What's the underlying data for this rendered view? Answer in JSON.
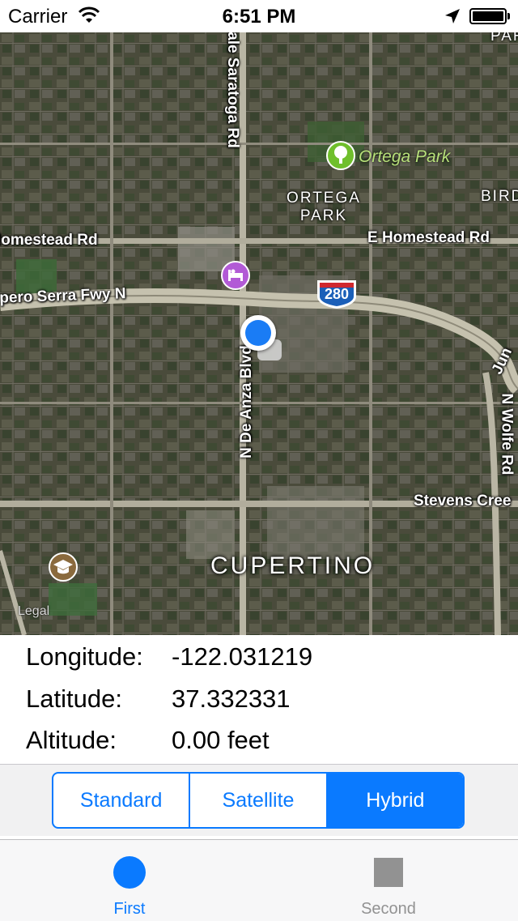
{
  "status_bar": {
    "carrier": "Carrier",
    "time": "6:51 PM"
  },
  "map": {
    "roads": {
      "saratoga": "ale Saratoga Rd",
      "homestead_w": "lomestead Rd",
      "homestead_e": "E Homestead Rd",
      "junipero": "ipero Serra Fwy N",
      "de_anza": "N De Anza Blvd",
      "wolfe": "N Wolfe Rd",
      "stevens": "Stevens Cree",
      "jun_fragment": "Jun",
      "par_fragment": "PAR",
      "bird_fragment": "BIRD"
    },
    "areas": {
      "ortega_line1": "ORTEGA",
      "ortega_line2": "PARK"
    },
    "poi": {
      "ortega_park": "Ortega Park"
    },
    "highway_shield": "280",
    "city": "CUPERTINO",
    "legal": "Legal"
  },
  "location": {
    "longitude_label": "Longitude:",
    "longitude_value": "-122.031219",
    "latitude_label": "Latitude:",
    "latitude_value": "37.332331",
    "altitude_label": "Altitude:",
    "altitude_value": "0.00 feet"
  },
  "map_type": {
    "options": [
      "Standard",
      "Satellite",
      "Hybrid"
    ],
    "selected": "Hybrid"
  },
  "tab_bar": {
    "tabs": [
      {
        "label": "First",
        "icon": "circle-icon",
        "active": true
      },
      {
        "label": "Second",
        "icon": "square-icon",
        "active": false
      }
    ]
  },
  "colors": {
    "accent": "#0a7aff",
    "inactive": "#929292"
  }
}
